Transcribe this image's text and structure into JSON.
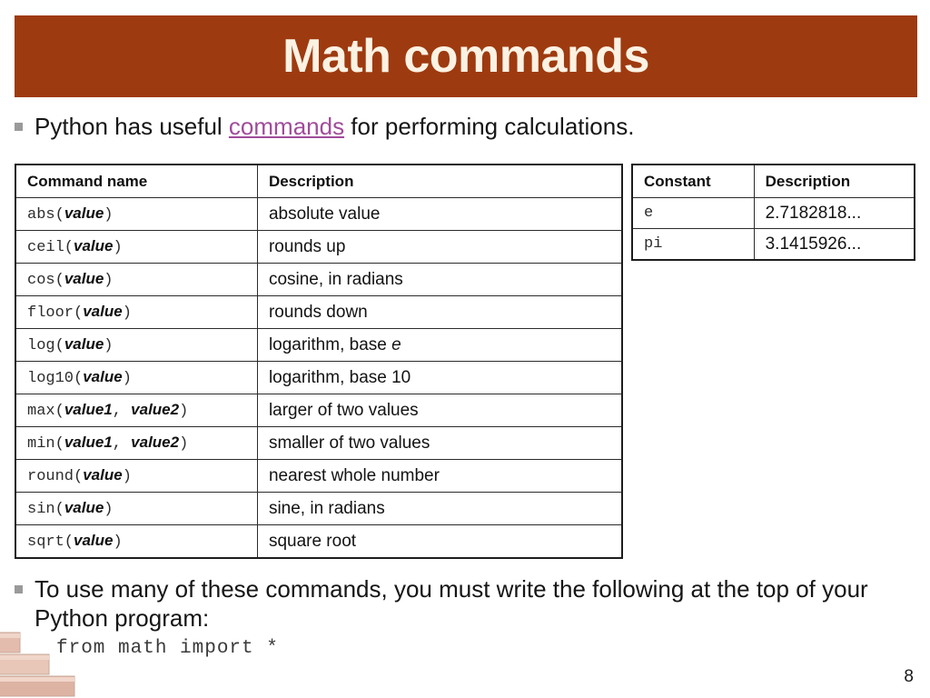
{
  "slide": {
    "title": "Math commands",
    "page_number": "8",
    "banner_color": "#9E3A10",
    "banner_text_color": "#FBF2E3",
    "link_color": "#A04C9B"
  },
  "bullets": [
    {
      "id": "bullet-intro",
      "prefix": "Python has useful ",
      "link": "commands",
      "suffix": " for performing calculations."
    },
    {
      "id": "bullet-import",
      "text": "To use many of these commands, you must write the following at the top of your Python program:"
    }
  ],
  "code": {
    "import_line": "from math import *"
  },
  "commands_table": {
    "headers": [
      "Command name",
      "Description"
    ],
    "rows": [
      {
        "name": "abs",
        "params": "value",
        "params2": "",
        "desc": "absolute value",
        "desc_italic": ""
      },
      {
        "name": "ceil",
        "params": "value",
        "params2": "",
        "desc": "rounds up",
        "desc_italic": ""
      },
      {
        "name": "cos",
        "params": "value",
        "params2": "",
        "desc": "cosine, in radians",
        "desc_italic": ""
      },
      {
        "name": "floor",
        "params": "value",
        "params2": "",
        "desc": "rounds down",
        "desc_italic": ""
      },
      {
        "name": "log",
        "params": "value",
        "params2": "",
        "desc": "logarithm, base ",
        "desc_italic": "e"
      },
      {
        "name": "log10",
        "params": "value",
        "params2": "",
        "desc": "logarithm, base 10",
        "desc_italic": ""
      },
      {
        "name": "max",
        "params": "value1",
        "params2": "value2",
        "desc": "larger of two values",
        "desc_italic": ""
      },
      {
        "name": "min",
        "params": "value1",
        "params2": "value2",
        "desc": "smaller of two values",
        "desc_italic": ""
      },
      {
        "name": "round",
        "params": "value",
        "params2": "",
        "desc": "nearest whole number",
        "desc_italic": ""
      },
      {
        "name": "sin",
        "params": "value",
        "params2": "",
        "desc": "sine, in radians",
        "desc_italic": ""
      },
      {
        "name": "sqrt",
        "params": "value",
        "params2": "",
        "desc": "square root",
        "desc_italic": ""
      }
    ]
  },
  "constants_table": {
    "headers": [
      "Constant",
      "Description"
    ],
    "rows": [
      {
        "name": "e",
        "desc": "2.7182818..."
      },
      {
        "name": "pi",
        "desc": "3.1415926..."
      }
    ]
  }
}
